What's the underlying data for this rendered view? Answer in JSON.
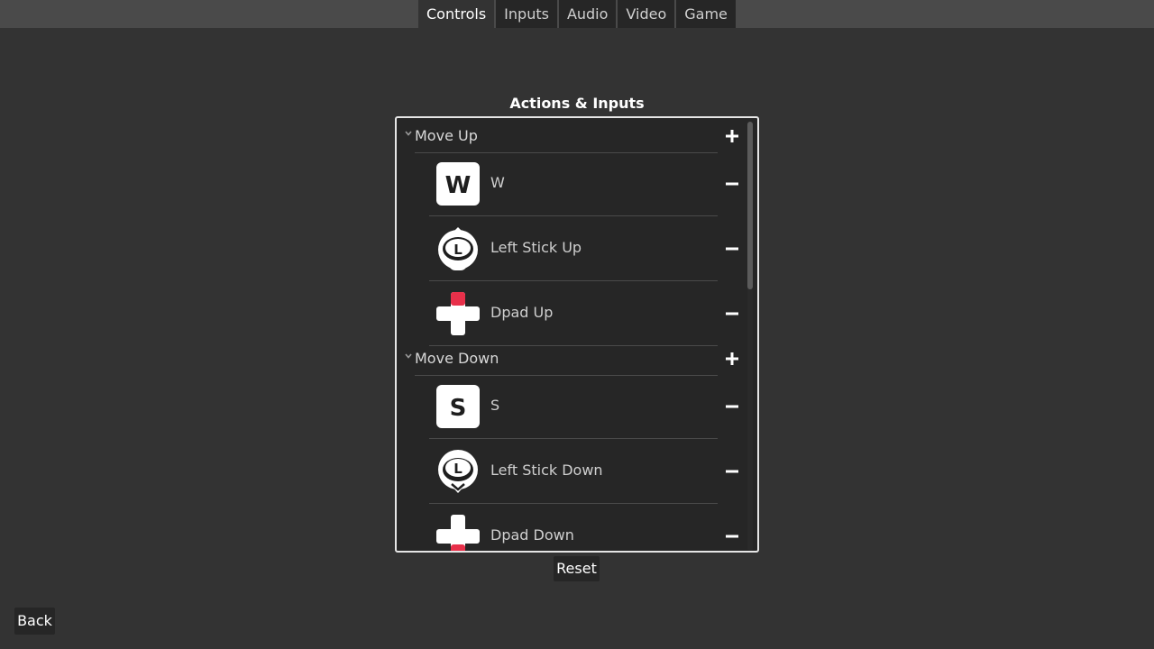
{
  "tabs": [
    "Controls",
    "Inputs",
    "Audio",
    "Video",
    "Game"
  ],
  "active_tab": "Controls",
  "panel_title": "Actions & Inputs",
  "actions": [
    {
      "name": "Move Up",
      "inputs": [
        {
          "label": "W",
          "glyph": "key-w-icon",
          "glyph_text": "W"
        },
        {
          "label": "Left Stick Up",
          "glyph": "left-stick-up-icon",
          "glyph_text": "L"
        },
        {
          "label": "Dpad Up",
          "glyph": "dpad-up-icon"
        }
      ]
    },
    {
      "name": "Move Down",
      "inputs": [
        {
          "label": "S",
          "glyph": "key-s-icon",
          "glyph_text": "S"
        },
        {
          "label": "Left Stick Down",
          "glyph": "left-stick-down-icon",
          "glyph_text": "L"
        },
        {
          "label": "Dpad Down",
          "glyph": "dpad-down-icon"
        }
      ]
    }
  ],
  "reset_label": "Reset",
  "back_label": "Back",
  "colors": {
    "background": "#333333",
    "panel": "#262626",
    "tabbar": "#4a4a4a",
    "dpad_highlight": "#e8304a"
  }
}
